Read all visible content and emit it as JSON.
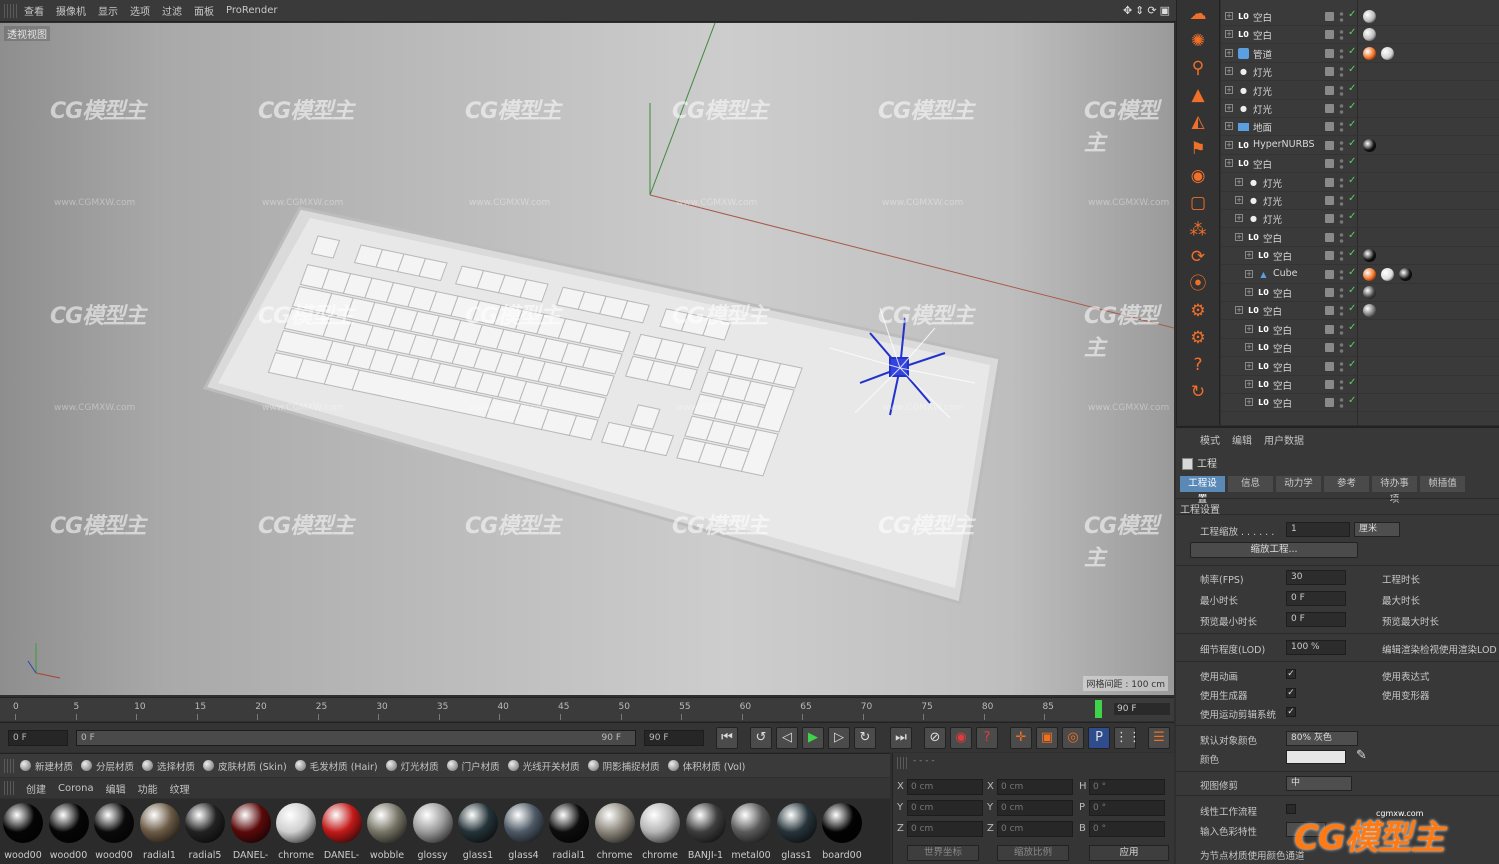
{
  "top_menu": {
    "items": [
      "查看",
      "摄像机",
      "显示",
      "选项",
      "过滤",
      "面板",
      "ProRender"
    ]
  },
  "viewport": {
    "label": "透视视图",
    "grid_spacing": "网格间距 : 100 cm",
    "watermark": "CG模型主",
    "watermark_url": "www.CGMXW.com"
  },
  "timeline": {
    "ticks": [
      "0",
      "5",
      "10",
      "15",
      "20",
      "25",
      "30",
      "35",
      "40",
      "45",
      "50",
      "55",
      "60",
      "65",
      "70",
      "75",
      "80",
      "85"
    ],
    "end_frame": "90 F"
  },
  "transport": {
    "current_frame": "0 F",
    "range_start": "0 F",
    "range_end": "90 F",
    "range_max": "90 F"
  },
  "material_toolbar": {
    "items": [
      "新建材质",
      "分层材质",
      "选择材质",
      "皮肤材质 (Skin)",
      "毛发材质 (Hair)",
      "灯光材质",
      "门户材质",
      "光线开关材质",
      "阴影捕捉材质",
      "体积材质 (Vol)"
    ]
  },
  "material_menu": {
    "items": [
      "创建",
      "Corona",
      "编辑",
      "功能",
      "纹理"
    ]
  },
  "materials": [
    {
      "name": "wood00",
      "color": "#050505"
    },
    {
      "name": "wood00",
      "color": "#060606"
    },
    {
      "name": "wood00",
      "color": "#0a0a0a"
    },
    {
      "name": "radial1",
      "color": "#6b5a45"
    },
    {
      "name": "radial5",
      "color": "#222222"
    },
    {
      "name": "DANEL-",
      "color": "#5b0a0a"
    },
    {
      "name": "chrome",
      "color": "#cfcfcf"
    },
    {
      "name": "DANEL-",
      "color": "#c21a1a"
    },
    {
      "name": "wobble",
      "color": "#777566"
    },
    {
      "name": "glossy",
      "color": "#9b9b9b"
    },
    {
      "name": "glass1",
      "color": "#243338"
    },
    {
      "name": "glass4",
      "color": "#4d5966"
    },
    {
      "name": "radial1",
      "color": "#0d0d0d"
    },
    {
      "name": "chrome",
      "color": "#8c877c"
    },
    {
      "name": "chrome",
      "color": "#b5b5b5"
    },
    {
      "name": "BANJI-1",
      "color": "#3d3d3d"
    },
    {
      "name": "metal00",
      "color": "#5a5a5a"
    },
    {
      "name": "glass1",
      "color": "#26343a"
    },
    {
      "name": "board00",
      "color": "#030303"
    }
  ],
  "coordinates": {
    "rows": [
      {
        "a": "X",
        "av": "0 cm",
        "b": "X",
        "bv": "0 cm",
        "c": "H",
        "cv": "0 °"
      },
      {
        "a": "Y",
        "av": "0 cm",
        "b": "Y",
        "bv": "0 cm",
        "c": "P",
        "cv": "0 °"
      },
      {
        "a": "Z",
        "av": "0 cm",
        "b": "Z",
        "bv": "0 cm",
        "c": "B",
        "cv": "0 °"
      }
    ],
    "world_coords": "世界坐标",
    "scale": "缩放比例",
    "apply": "应用"
  },
  "objects": [
    {
      "name": "空白",
      "indent": 0,
      "icon": "L0",
      "tags": [
        "#bbbbbb"
      ]
    },
    {
      "name": "空白",
      "indent": 0,
      "icon": "L0",
      "tags": [
        "#bbbbbb"
      ]
    },
    {
      "name": "管道",
      "indent": 0,
      "icon": "tube",
      "tags": [
        "#f07020",
        "#d0d0d0"
      ]
    },
    {
      "name": "灯光",
      "indent": 0,
      "icon": "light",
      "tags": []
    },
    {
      "name": "灯光",
      "indent": 0,
      "icon": "light",
      "tags": []
    },
    {
      "name": "灯光",
      "indent": 0,
      "icon": "light",
      "tags": []
    },
    {
      "name": "地面",
      "indent": 0,
      "icon": "floor",
      "tags": []
    },
    {
      "name": "HyperNURBS",
      "indent": 0,
      "icon": "L0",
      "tags": [
        "#111111"
      ]
    },
    {
      "name": "空白",
      "indent": 0,
      "icon": "L0",
      "tags": []
    },
    {
      "name": "灯光",
      "indent": 1,
      "icon": "light",
      "tags": []
    },
    {
      "name": "灯光",
      "indent": 1,
      "icon": "light",
      "tags": []
    },
    {
      "name": "灯光",
      "indent": 1,
      "icon": "light",
      "tags": []
    },
    {
      "name": "空白",
      "indent": 1,
      "icon": "L0",
      "tags": []
    },
    {
      "name": "空白",
      "indent": 2,
      "icon": "L0",
      "tags": [
        "#111111"
      ]
    },
    {
      "name": "Cube",
      "indent": 2,
      "icon": "cube",
      "tags": [
        "#f07020",
        "#dddddd",
        "#111111"
      ]
    },
    {
      "name": "空白",
      "indent": 2,
      "icon": "L0",
      "tags": [
        "#444444"
      ]
    },
    {
      "name": "空白",
      "indent": 1,
      "icon": "L0",
      "tags": [
        "#777777"
      ]
    },
    {
      "name": "空白",
      "indent": 2,
      "icon": "L0",
      "tags": []
    },
    {
      "name": "空白",
      "indent": 2,
      "icon": "L0",
      "tags": []
    },
    {
      "name": "空白",
      "indent": 2,
      "icon": "L0",
      "tags": []
    },
    {
      "name": "空白",
      "indent": 2,
      "icon": "L0",
      "tags": []
    },
    {
      "name": "空白",
      "indent": 2,
      "icon": "L0",
      "tags": []
    }
  ],
  "attributes": {
    "menu": [
      "模式",
      "编辑",
      "用户数据"
    ],
    "header": "工程",
    "tabs": [
      "工程设置",
      "信息",
      "动力学",
      "参考",
      "待办事项",
      "帧插值"
    ],
    "section": "工程设置",
    "project_scale_label": "工程缩放 . . . . . .",
    "project_scale_value": "1",
    "project_scale_unit": "厘米",
    "scale_project_btn": "缩放工程...",
    "fps_label": "帧率(FPS)",
    "fps_value": "30",
    "project_time_label": "工程时长",
    "min_time_label": "最小时长",
    "min_time_value": "0 F",
    "max_time_label": "最大时长",
    "preview_min_label": "预览最小时长",
    "preview_min_value": "0 F",
    "preview_max_label": "预览最大时长",
    "lod_label": "细节程度(LOD)",
    "lod_value": "100 %",
    "render_lod_label": "编辑渲染检视使用渲染LOD",
    "use_anim_label": "使用动画",
    "use_expr_label": "使用表达式",
    "use_generator_label": "使用生成器",
    "use_deformer_label": "使用变形器",
    "use_motion_label": "使用运动剪辑系统",
    "default_color_label": "默认对象颜色",
    "default_color_value": "80% 灰色",
    "color_label": "颜色",
    "clipping_label": "视图修剪",
    "clipping_value": "中",
    "linear_workflow_label": "线性工作流程",
    "input_color_label": "输入色彩特性",
    "node_material_label": "为节点材质使用颜色通道"
  },
  "logo": {
    "text": "CG模型主",
    "sub": "cgmxw.com"
  }
}
